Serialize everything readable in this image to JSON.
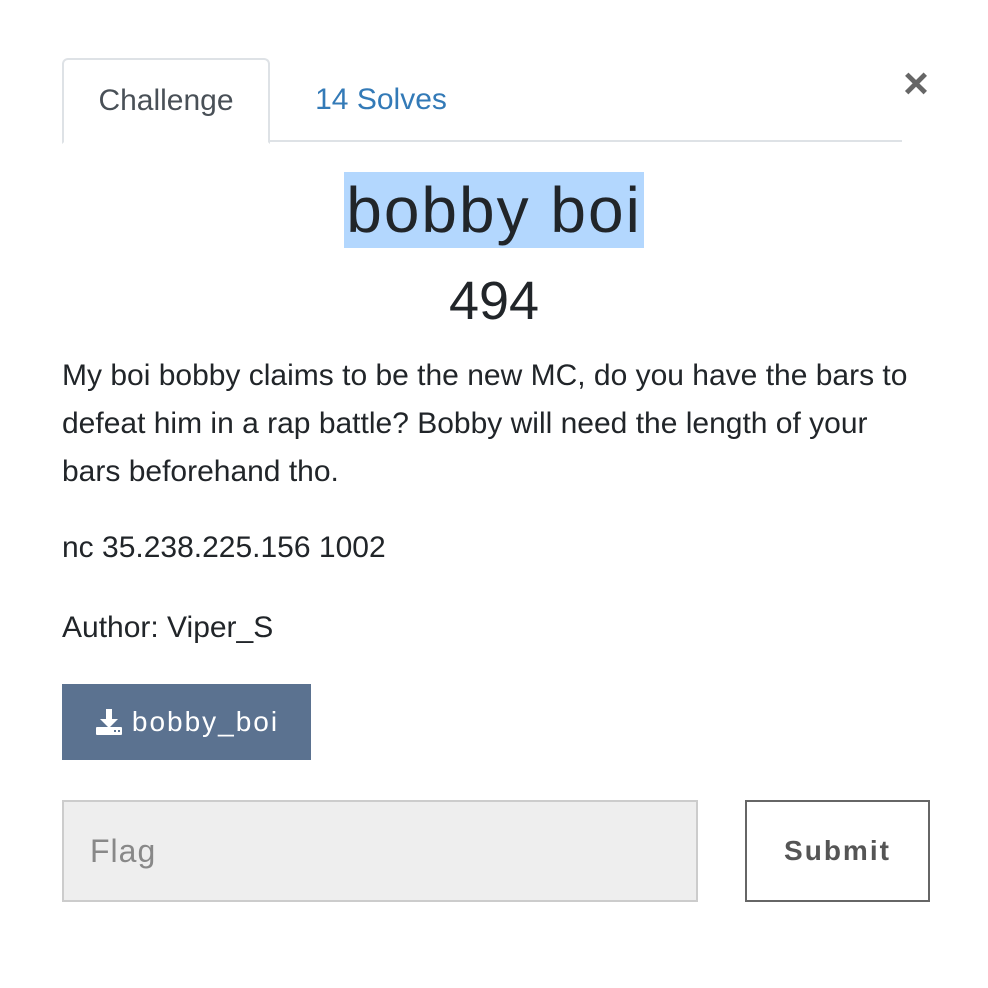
{
  "tabs": {
    "challenge_label": "Challenge",
    "solves_label": "14 Solves"
  },
  "close_symbol": "×",
  "challenge": {
    "name": "bobby boi",
    "value": "494",
    "description": "My boi bobby claims to be the new MC, do you have the bars to defeat him in a rap battle? Bobby will need the length of your bars beforehand tho.",
    "connection": "nc 35.238.225.156 1002",
    "author": "Author: Viper_S"
  },
  "file": {
    "label": "bobby_boi",
    "icon": "download-icon"
  },
  "form": {
    "flag_placeholder": "Flag",
    "flag_value": "",
    "submit_label": "Submit"
  },
  "colors": {
    "file_button": "#5b7290",
    "title_highlight": "#b3d7fe",
    "solves_link": "#337ab7"
  }
}
